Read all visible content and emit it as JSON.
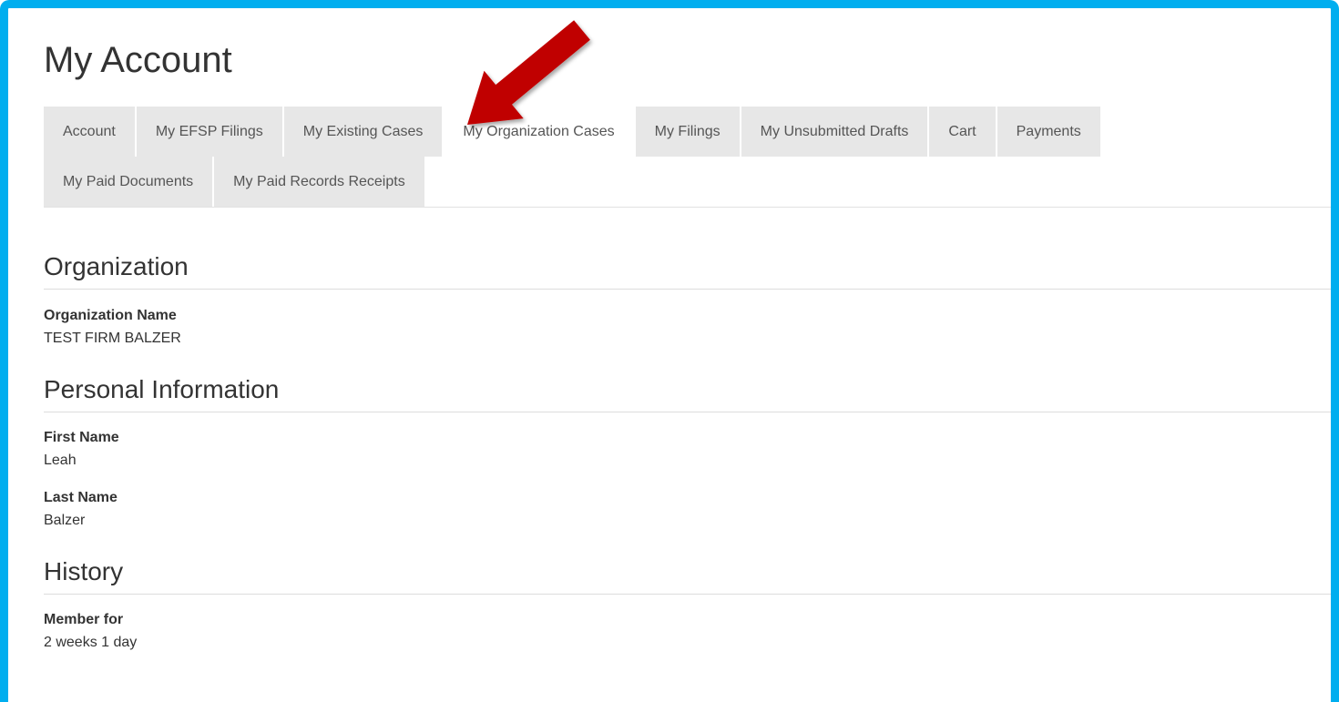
{
  "page": {
    "title": "My Account"
  },
  "tabs": [
    {
      "label": "Account"
    },
    {
      "label": "My EFSP Filings"
    },
    {
      "label": "My Existing Cases"
    },
    {
      "label": "My Organization Cases"
    },
    {
      "label": "My Filings"
    },
    {
      "label": "My Unsubmitted Drafts"
    },
    {
      "label": "Cart"
    },
    {
      "label": "Payments"
    },
    {
      "label": "My Paid Documents"
    },
    {
      "label": "My Paid Records Receipts"
    }
  ],
  "organization": {
    "heading": "Organization",
    "name_label": "Organization Name",
    "name_value": "TEST FIRM BALZER"
  },
  "personal": {
    "heading": "Personal Information",
    "first_name_label": "First Name",
    "first_name_value": "Leah",
    "last_name_label": "Last Name",
    "last_name_value": "Balzer"
  },
  "history": {
    "heading": "History",
    "member_label": "Member for",
    "member_value": "2 weeks 1 day"
  },
  "colors": {
    "frame_border": "#00aeef",
    "tab_background": "#e7e7e7",
    "annotation_arrow": "#c00000"
  },
  "icons": {
    "annotation": "red-arrow-icon"
  }
}
